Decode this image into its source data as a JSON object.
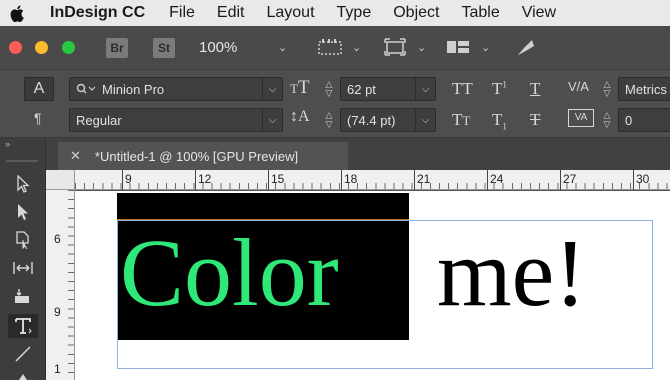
{
  "menubar": {
    "app_name": "InDesign CC",
    "items": [
      "File",
      "Edit",
      "Layout",
      "Type",
      "Object",
      "Table",
      "View"
    ]
  },
  "appbar": {
    "bridge_label": "Br",
    "stock_label": "St",
    "zoom": "100%"
  },
  "control_panel": {
    "character_mode": "A",
    "paragraph_mode": "¶",
    "font_family": "Minion Pro",
    "font_style": "Regular",
    "font_size": "62 pt",
    "leading": "(74.4 pt)",
    "kerning": "Metrics",
    "tracking": "0"
  },
  "document": {
    "tab_title": "*Untitled-1 @ 100% [GPU Preview]"
  },
  "rulers": {
    "horizontal_labels": [
      "9",
      "12",
      "15",
      "18",
      "21",
      "24",
      "27",
      "30"
    ],
    "vertical_labels": [
      "6",
      "9",
      "1"
    ]
  },
  "canvas": {
    "selected_text": "Color",
    "remaining_text": " me!"
  },
  "colors": {
    "text_fill_selected": "#2ee878",
    "selection_highlight": "#000000",
    "frame_edge": "#8fb1e0"
  }
}
